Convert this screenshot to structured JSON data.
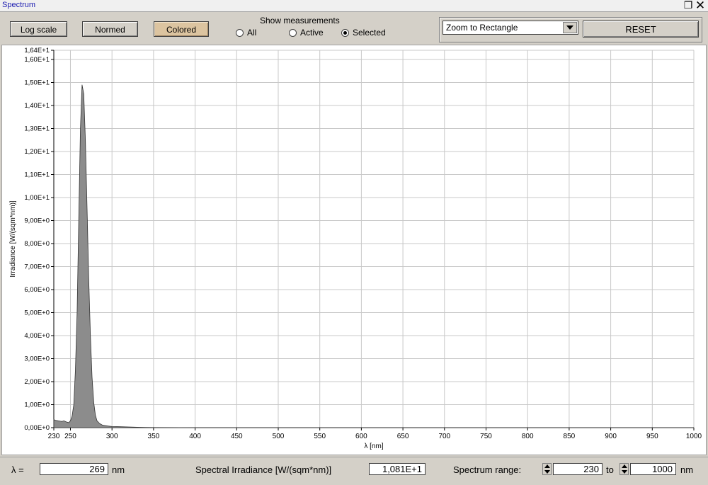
{
  "window": {
    "title": "Spectrum",
    "restore_icon": "restore-icon",
    "close_icon": "close-icon"
  },
  "toolbar": {
    "log_scale": "Log scale",
    "normed": "Normed",
    "colored": "Colored",
    "show_measurements": "Show measurements",
    "radio_all": "All",
    "radio_active": "Active",
    "radio_selected": "Selected",
    "selected_radio": "Selected",
    "zoom_mode": "Zoom to Rectangle",
    "reset": "RESET"
  },
  "colors": {
    "active_button": "#dcc4a0",
    "fill": "#8c8c8c",
    "grid": "#c8c8c8"
  },
  "chart_data": {
    "type": "area",
    "xlabel": "λ [nm]",
    "ylabel": "Irradiance [W/(sqm*nm)]",
    "xlim": [
      230,
      1000
    ],
    "ylim": [
      0,
      16.4
    ],
    "x_ticks": [
      {
        "v": 230,
        "label": "230"
      },
      {
        "v": 250,
        "label": "250"
      },
      {
        "v": 300,
        "label": "300"
      },
      {
        "v": 350,
        "label": "350"
      },
      {
        "v": 400,
        "label": "400"
      },
      {
        "v": 450,
        "label": "450"
      },
      {
        "v": 500,
        "label": "500"
      },
      {
        "v": 550,
        "label": "550"
      },
      {
        "v": 600,
        "label": "600"
      },
      {
        "v": 650,
        "label": "650"
      },
      {
        "v": 700,
        "label": "700"
      },
      {
        "v": 750,
        "label": "750"
      },
      {
        "v": 800,
        "label": "800"
      },
      {
        "v": 850,
        "label": "850"
      },
      {
        "v": 900,
        "label": "900"
      },
      {
        "v": 950,
        "label": "950"
      },
      {
        "v": 1000,
        "label": "1000"
      }
    ],
    "y_ticks": [
      {
        "v": 0,
        "label": "0,00E+0"
      },
      {
        "v": 1,
        "label": "1,00E+0"
      },
      {
        "v": 2,
        "label": "2,00E+0"
      },
      {
        "v": 3,
        "label": "3,00E+0"
      },
      {
        "v": 4,
        "label": "4,00E+0"
      },
      {
        "v": 5,
        "label": "5,00E+0"
      },
      {
        "v": 6,
        "label": "6,00E+0"
      },
      {
        "v": 7,
        "label": "7,00E+0"
      },
      {
        "v": 8,
        "label": "8,00E+0"
      },
      {
        "v": 9,
        "label": "9,00E+0"
      },
      {
        "v": 10,
        "label": "1,00E+1"
      },
      {
        "v": 11,
        "label": "1,10E+1"
      },
      {
        "v": 12,
        "label": "1,20E+1"
      },
      {
        "v": 13,
        "label": "1,30E+1"
      },
      {
        "v": 14,
        "label": "1,40E+1"
      },
      {
        "v": 15,
        "label": "1,50E+1"
      },
      {
        "v": 16,
        "label": "1,60E+1"
      },
      {
        "v": 16.4,
        "label": "1,64E+1"
      }
    ],
    "grid": true,
    "series": [
      {
        "x": [
          230,
          232,
          235,
          238,
          240,
          242,
          245,
          248,
          250,
          252,
          254,
          256,
          258,
          260,
          262,
          264,
          266,
          268,
          270,
          272,
          274,
          276,
          278,
          280,
          282,
          285,
          288,
          290,
          295,
          300,
          310,
          320,
          330,
          340,
          350,
          400,
          500,
          600,
          700,
          800,
          900,
          1000
        ],
        "y": [
          0.35,
          0.32,
          0.3,
          0.28,
          0.27,
          0.3,
          0.25,
          0.22,
          0.3,
          0.5,
          1.0,
          2.5,
          5.0,
          9.0,
          13.0,
          14.9,
          14.5,
          12.5,
          9.5,
          6.5,
          4.0,
          2.2,
          1.1,
          0.55,
          0.3,
          0.18,
          0.12,
          0.1,
          0.07,
          0.05,
          0.04,
          0.03,
          0.02,
          0.01,
          0.005,
          0,
          0,
          0,
          0,
          0,
          0,
          0
        ]
      }
    ]
  },
  "bottom": {
    "lambda_label": "λ =",
    "lambda_value": "269",
    "lambda_unit": "nm",
    "irr_label": "Spectral Irradiance [W/(sqm*nm)]",
    "irr_value": "1,081E+1",
    "range_label": "Spectrum range:",
    "range_from": "230",
    "range_to_label": "to",
    "range_to": "1000",
    "range_unit": "nm"
  }
}
